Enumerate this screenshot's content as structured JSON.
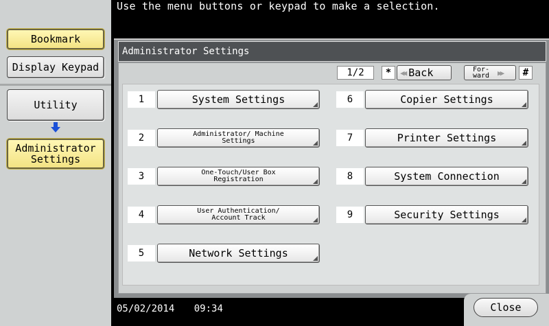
{
  "top_message": "Use the menu buttons or keypad to make a selection.",
  "sidebar": {
    "bookmark": "Bookmark",
    "display_keypad": "Display Keypad",
    "utility": "Utility",
    "administrator_settings": "Administrator Settings"
  },
  "panel": {
    "title": "Administrator Settings",
    "page_indicator": "1/2",
    "star_key": "*",
    "back": "Back",
    "forward": "For-ward",
    "hash_key": "#"
  },
  "menu": [
    {
      "num": "1",
      "label": "System Settings"
    },
    {
      "num": "2",
      "label": "Administrator/ Machine Settings"
    },
    {
      "num": "3",
      "label": "One-Touch/User Box Registration"
    },
    {
      "num": "4",
      "label": "User Authentication/ Account Track"
    },
    {
      "num": "5",
      "label": "Network Settings"
    },
    {
      "num": "6",
      "label": "Copier Settings"
    },
    {
      "num": "7",
      "label": "Printer Settings"
    },
    {
      "num": "8",
      "label": "System Connection"
    },
    {
      "num": "9",
      "label": "Security Settings"
    }
  ],
  "status": {
    "date": "05/02/2014",
    "time": "09:34"
  },
  "close": "Close",
  "colors": {
    "accent_yellow": "#f3e384",
    "panel_gray": "#cfd2d2",
    "title_bar": "#4e5154",
    "arrow_blue": "#1a50d8"
  }
}
